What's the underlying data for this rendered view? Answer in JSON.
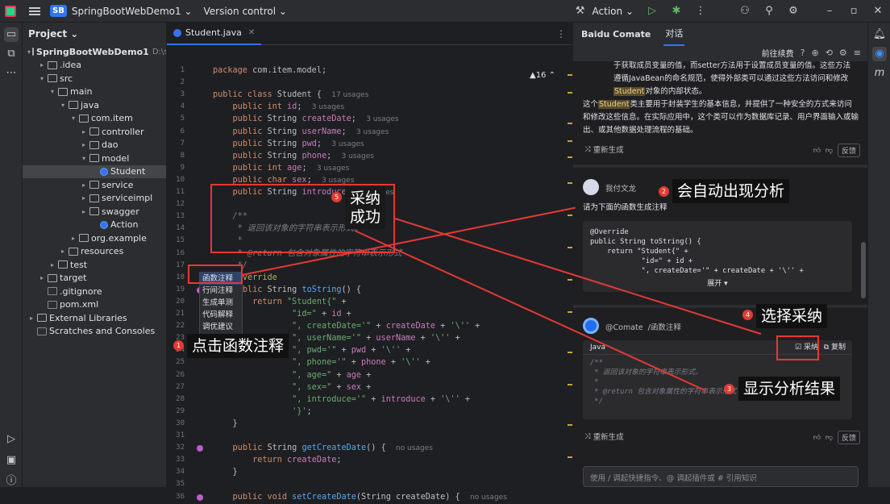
{
  "titlebar": {
    "badge": "SB",
    "project": "SpringBootWebDemo1 ⌄",
    "vcs": "Version control ⌄",
    "run_config": "Action ⌄"
  },
  "project_panel": {
    "title": "Project ⌄",
    "tree": [
      {
        "label": "SpringBootWebDemo1",
        "hint": "D:\\save\\",
        "indent": 0,
        "open": true,
        "bold": true
      },
      {
        "label": ".idea",
        "indent": 1,
        "open": false
      },
      {
        "label": "src",
        "indent": 1,
        "open": true
      },
      {
        "label": "main",
        "indent": 2,
        "open": true
      },
      {
        "label": "java",
        "indent": 3,
        "open": true
      },
      {
        "label": "com.item",
        "indent": 4,
        "open": true
      },
      {
        "label": "controller",
        "indent": 5,
        "open": false
      },
      {
        "label": "dao",
        "indent": 5,
        "open": false
      },
      {
        "label": "model",
        "indent": 5,
        "open": true
      },
      {
        "label": "Student",
        "indent": 6,
        "cls": true,
        "selected": true
      },
      {
        "label": "service",
        "indent": 5,
        "open": false
      },
      {
        "label": "serviceimpl",
        "indent": 5,
        "open": false
      },
      {
        "label": "swagger",
        "indent": 5,
        "open": false
      },
      {
        "label": "Action",
        "indent": 6,
        "cls": true
      },
      {
        "label": "org.example",
        "indent": 4,
        "open": false
      },
      {
        "label": "resources",
        "indent": 3,
        "open": false
      },
      {
        "label": "test",
        "indent": 2,
        "open": false
      },
      {
        "label": "target",
        "indent": 1,
        "open": false
      },
      {
        "label": ".gitignore",
        "indent": 1,
        "file": true
      },
      {
        "label": "pom.xml",
        "indent": 1,
        "file": true
      },
      {
        "label": "External Libraries",
        "indent": 0,
        "open": false
      },
      {
        "label": "Scratches and Consoles",
        "indent": 0,
        "file": true
      }
    ]
  },
  "editor": {
    "tab": "Student.java",
    "warnings": "▲16 ⌃",
    "lines": [
      {
        "n": "1",
        "html": "<span class='kw'>package</span> com.item.model;"
      },
      {
        "n": "2",
        "html": ""
      },
      {
        "n": "3",
        "html": "<span class='kw'>public class</span> Student {  <span class='us'>17 usages</span>"
      },
      {
        "n": "4",
        "html": "    <span class='kw'>public int</span> <span class='fld'>id</span>;  <span class='us'>3 usages</span>"
      },
      {
        "n": "5",
        "html": "    <span class='kw'>public</span> String <span class='fld'>createDate</span>;  <span class='us'>3 usages</span>"
      },
      {
        "n": "6",
        "html": "    <span class='kw'>public</span> String <span class='fld'>userName</span>;  <span class='us'>3 usages</span>"
      },
      {
        "n": "7",
        "html": "    <span class='kw'>public</span> String <span class='fld'>pwd</span>;  <span class='us'>3 usages</span>"
      },
      {
        "n": "8",
        "html": "    <span class='kw'>public</span> String <span class='fld'>phone</span>;  <span class='us'>3 usages</span>"
      },
      {
        "n": "9",
        "html": "    <span class='kw'>public int</span> <span class='fld'>age</span>;  <span class='us'>3 usages</span>"
      },
      {
        "n": "10",
        "html": "    <span class='kw'>public char</span> <span class='fld'>sex</span>;  <span class='us'>3 usages</span>"
      },
      {
        "n": "11",
        "html": "    <span class='kw'>public</span> String <span class='fld'>introduce</span>;  <span class='us'>3 usages</span>"
      },
      {
        "n": "12",
        "html": ""
      },
      {
        "n": "13",
        "html": "    <span class='cm'>/**</span>"
      },
      {
        "n": "14",
        "html": "<span class='cm'>     * 返回该对象的字符串表示形式。</span>"
      },
      {
        "n": "15",
        "html": "<span class='cm'>     *</span>"
      },
      {
        "n": "16",
        "html": "<span class='cm'>     * @return 包含对象属性的字符串表示形式</span>"
      },
      {
        "n": "17",
        "html": "<span class='cm'>     */</span>"
      },
      {
        "n": "18",
        "html": "    <span class='ann'>@Override</span>"
      },
      {
        "n": "19",
        "html": "    <span class='kw'>public</span> String <span class='fn'>toString</span>() {",
        "gutter": true
      },
      {
        "n": "20",
        "html": "        <span class='kw'>return</span> <span class='str'>\"Student{\"</span> +"
      },
      {
        "n": "21",
        "html": "                <span class='str'>\"id=\"</span> + <span class='fld'>id</span> +"
      },
      {
        "n": "22",
        "html": "                <span class='str'>\", createDate='\"</span> + <span class='fld'>createDate</span> + <span class='str'>'\\''</span> +"
      },
      {
        "n": "23",
        "html": "                <span class='str'>\", userName='\"</span> + <span class='fld'>userName</span> + <span class='str'>'\\''</span> +"
      },
      {
        "n": "24",
        "html": "                <span class='str'>\", pwd='\"</span> + <span class='fld'>pwd</span> + <span class='str'>'\\''</span> +"
      },
      {
        "n": "25",
        "html": "                <span class='str'>\", phone='\"</span> + <span class='fld'>phone</span> + <span class='str'>'\\''</span> +"
      },
      {
        "n": "26",
        "html": "                <span class='str'>\", age=\"</span> + <span class='fld'>age</span> +"
      },
      {
        "n": "27",
        "html": "                <span class='str'>\", sex=\"</span> + <span class='fld'>sex</span> +"
      },
      {
        "n": "28",
        "html": "                <span class='str'>\", introduce='\"</span> + <span class='fld'>introduce</span> + <span class='str'>'\\''</span> +"
      },
      {
        "n": "29",
        "html": "                <span class='str'>'}'</span>;"
      },
      {
        "n": "30",
        "html": "    }"
      },
      {
        "n": "31",
        "html": ""
      },
      {
        "n": "32",
        "html": "    <span class='kw'>public</span> String <span class='fn'>getCreateDate</span>() {  <span class='us'>no usages</span>",
        "gutter": true
      },
      {
        "n": "33",
        "html": "        <span class='kw'>return</span> <span class='fld'>createDate</span>;"
      },
      {
        "n": "34",
        "html": "    }"
      },
      {
        "n": "35",
        "html": ""
      },
      {
        "n": "36",
        "html": "    <span class='kw'>public void</span> <span class='fn'>setCreateDate</span>(String createDate) {  <span class='us'>no usages</span>",
        "gutter": true
      }
    ],
    "popup": [
      "函数注释",
      "行间注释",
      "生成单测",
      "代码解释",
      "调优建议"
    ]
  },
  "comate": {
    "title": "Baidu Comate",
    "tab": "对话",
    "sub_link": "前往续费",
    "answer_p1": "于获取成员变量的值，而setter方法用于设置成员变量的值。这些方法遵循JavaBean的命名规范，使得外部类可以通过这些方法访问和修改",
    "answer_p1_hl": "Student",
    "answer_p1_tail": "对象的内部状态。",
    "answer_p2_pre": "这个",
    "answer_p2_hl": "Student",
    "answer_p2": "类主要用于封装学生的基本信息，并提供了一种安全的方式来访问和修改这些信息。在实际应用中，这个类可以作为数据库记录、用户界面输入或输出、或其他数据处理流程的基础。",
    "regen": "重新生成",
    "feedback": "反馈",
    "user_name": "我付文龙",
    "user_msg": "请为下面的函数生成注释",
    "user_code": [
      "@Override",
      "public String toString() {",
      "    return \"Student{\" +",
      "            \"id=\" + id +",
      "            \", createDate='\" + createDate + '\\'' +"
    ],
    "expand": "展开 ▾",
    "bot_name": "@Comate",
    "bot_cmd": "/函数注释",
    "bot_lang": "Java",
    "adopt": "采纳",
    "copy": "复制",
    "bot_code": [
      "/**",
      " * 返回该对象的字符串表示形式。",
      " *",
      " * @return 包含对象属性的字符串表示形式",
      " */"
    ],
    "input_placeholder": "使用 / 调起快捷指令、@ 调起插件或 # 引用知识"
  },
  "callouts": {
    "c1": "点击函数注释",
    "c2": "会自动出现分析",
    "c3": "显示分析结果",
    "c4": "选择采纳",
    "c5": "采纳\n成功",
    "n1": "1",
    "n2": "2",
    "n3": "3",
    "n4": "4",
    "n5": "5"
  },
  "colors": {
    "accent": "#3574f0",
    "annotation_red": "#e53935"
  }
}
